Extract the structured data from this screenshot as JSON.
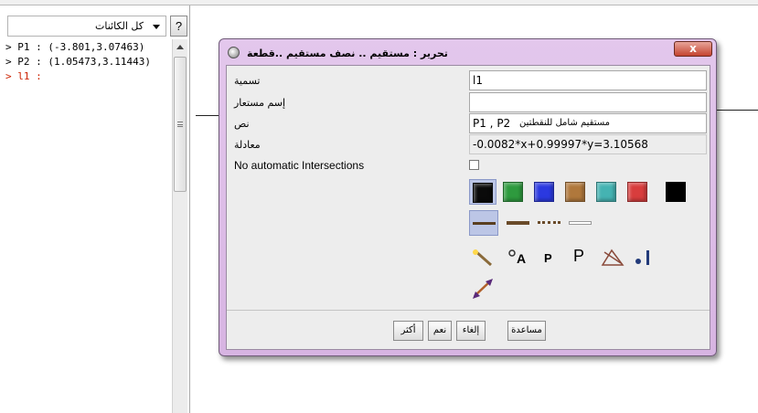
{
  "algebra": {
    "filter_value": "كل الكائنات",
    "help_label": "?",
    "objects": [
      {
        "text": "> P1 : (-3.801,3.07463)",
        "selected": false
      },
      {
        "text": "> P2 : (1.05473,3.11443)",
        "selected": false
      },
      {
        "text": "> l1 :",
        "selected": true
      }
    ]
  },
  "dialog": {
    "title": "تحرير : مستقيم .. نصف مستقيم ..قطعة",
    "close_label": "x",
    "fields": {
      "name_label": "تسمية",
      "name_value": "l1",
      "alias_label": "إسم مستعار",
      "alias_value": "",
      "text_label": "نص",
      "text_value_ltr": "P1 , P2",
      "text_value_rtl": "مستقيم شامل للنقطتين",
      "equation_label": "معادلة",
      "equation_value": "-0.0082*x+0.99997*y=3.10568",
      "no_intersections_label": "No automatic Intersections",
      "no_intersections_checked": false
    },
    "colors": [
      "#0a0a0a",
      "#2e9a3e",
      "#2b39e0",
      "#b0783c",
      "#45b3b2",
      "#d83d3d",
      "#000000"
    ],
    "selected_color_index": 0,
    "line_styles": [
      "solid-thick",
      "solid-brown",
      "dotted",
      "solid-white"
    ],
    "selected_line_style_index": 0,
    "tools": [
      {
        "icon": "magic-wand-icon"
      },
      {
        "icon": "point-label-icon",
        "text": "A"
      },
      {
        "icon": "small-p-icon",
        "text": "P"
      },
      {
        "icon": "large-p-icon",
        "text": "P"
      },
      {
        "icon": "angle-style-icon"
      },
      {
        "icon": "point-size-icon"
      },
      {
        "icon": "arrow-line-icon"
      }
    ],
    "buttons": {
      "more": "أكثر",
      "ok": "نعم",
      "cancel": "إلغاء",
      "help": "مساعدة"
    }
  }
}
